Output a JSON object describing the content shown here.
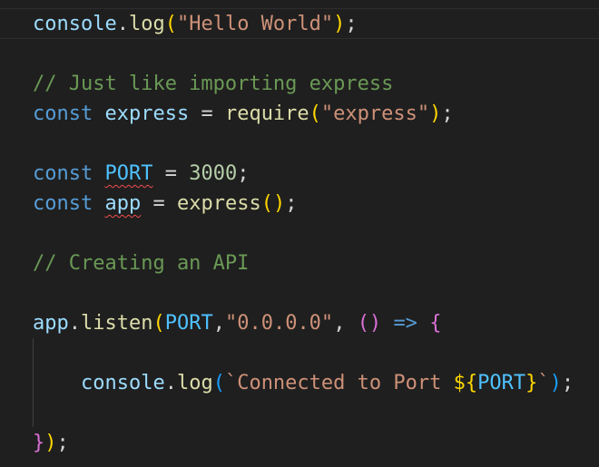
{
  "editor": {
    "theme_background": "#1f1f1f",
    "lines": [
      {
        "tokens": [
          {
            "t": "console"
          },
          {
            "t": "."
          },
          {
            "t": "log"
          },
          {
            "t": "("
          },
          {
            "t": "\"Hello World\""
          },
          {
            "t": ")"
          },
          {
            "t": ";"
          }
        ]
      },
      {
        "tokens": []
      },
      {
        "tokens": [
          {
            "t": "// Just like importing express"
          }
        ]
      },
      {
        "tokens": [
          {
            "t": "const"
          },
          {
            "t": " "
          },
          {
            "t": "express"
          },
          {
            "t": " = "
          },
          {
            "t": "require"
          },
          {
            "t": "("
          },
          {
            "t": "\"express\""
          },
          {
            "t": ")"
          },
          {
            "t": ";"
          }
        ]
      },
      {
        "tokens": []
      },
      {
        "tokens": [
          {
            "t": "const"
          },
          {
            "t": " "
          },
          {
            "t": "PORT"
          },
          {
            "t": " = "
          },
          {
            "t": "3000"
          },
          {
            "t": ";"
          }
        ]
      },
      {
        "tokens": [
          {
            "t": "const"
          },
          {
            "t": " "
          },
          {
            "t": "app"
          },
          {
            "t": " = "
          },
          {
            "t": "express"
          },
          {
            "t": "("
          },
          {
            "t": ")"
          },
          {
            "t": ";"
          }
        ]
      },
      {
        "tokens": []
      },
      {
        "tokens": [
          {
            "t": "// Creating an API"
          }
        ]
      },
      {
        "tokens": []
      },
      {
        "tokens": [
          {
            "t": "app"
          },
          {
            "t": "."
          },
          {
            "t": "listen"
          },
          {
            "t": "("
          },
          {
            "t": "PORT"
          },
          {
            "t": ","
          },
          {
            "t": "\"0.0.0.0\""
          },
          {
            "t": ", "
          },
          {
            "t": "()"
          },
          {
            "t": " "
          },
          {
            "t": "=>"
          },
          {
            "t": " "
          },
          {
            "t": "{"
          }
        ]
      },
      {
        "tokens": []
      },
      {
        "tokens": [
          {
            "t": "    "
          },
          {
            "t": "console"
          },
          {
            "t": "."
          },
          {
            "t": "log"
          },
          {
            "t": "("
          },
          {
            "t": "`Connected to Port "
          },
          {
            "t": "${"
          },
          {
            "t": "PORT"
          },
          {
            "t": "}"
          },
          {
            "t": "`"
          },
          {
            "t": ")"
          },
          {
            "t": ";"
          }
        ]
      },
      {
        "tokens": []
      },
      {
        "tokens": [
          {
            "t": "}"
          },
          {
            "t": ")"
          },
          {
            "t": ";"
          }
        ]
      }
    ]
  }
}
